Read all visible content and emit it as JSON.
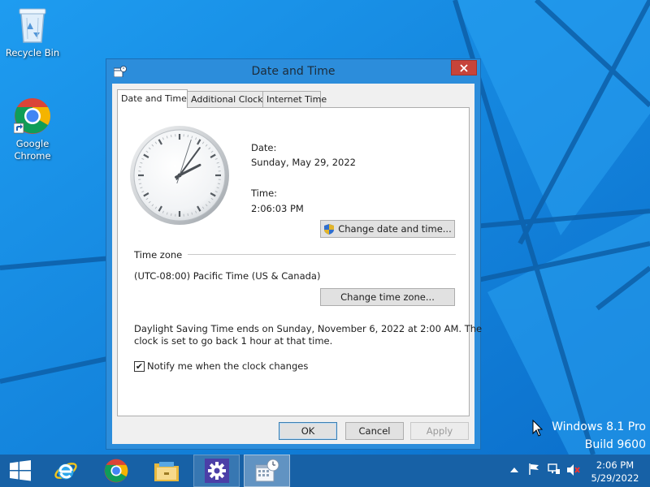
{
  "desktop": {
    "icons": [
      {
        "label": "Recycle Bin",
        "icon": "recycle-bin-icon"
      },
      {
        "label_line1": "Google",
        "label_line2": "Chrome",
        "icon": "chrome-icon"
      }
    ],
    "watermark": {
      "line1": "Windows 8.1 Pro",
      "line2": "Build 9600"
    }
  },
  "dialog": {
    "title": "Date and Time",
    "tabs": [
      {
        "label": "Date and Time",
        "active": true
      },
      {
        "label": "Additional Clocks",
        "active": false
      },
      {
        "label": "Internet Time",
        "active": false
      }
    ],
    "clock": {
      "hours": 2,
      "minutes": 6,
      "seconds": 3
    },
    "date_label": "Date:",
    "date_value": "Sunday, May 29, 2022",
    "time_label": "Time:",
    "time_value": "2:06:03 PM",
    "change_datetime_label": "Change date and time...",
    "timezone_heading": "Time zone",
    "timezone_value": "(UTC-08:00) Pacific Time (US & Canada)",
    "change_timezone_label": "Change time zone...",
    "dst_line1": "Daylight Saving Time ends on Sunday, November 6, 2022 at 2:00 AM. The",
    "dst_line2": "clock is set to go back 1 hour at that time.",
    "notify_label": "Notify me when the clock changes",
    "notify_checked": true,
    "ok_label": "OK",
    "cancel_label": "Cancel",
    "apply_label": "Apply",
    "apply_enabled": false
  },
  "taskbar": {
    "items": [
      "start",
      "internet-explorer",
      "chrome",
      "file-explorer",
      "control-panel",
      "date-and-time"
    ],
    "clock_time": "2:06 PM",
    "clock_date": "5/29/2022"
  },
  "colors": {
    "desktop": "#1a8be0",
    "window_frame": "#2c8ddb",
    "close_button": "#c7443a",
    "taskbar": "#1761a6"
  }
}
